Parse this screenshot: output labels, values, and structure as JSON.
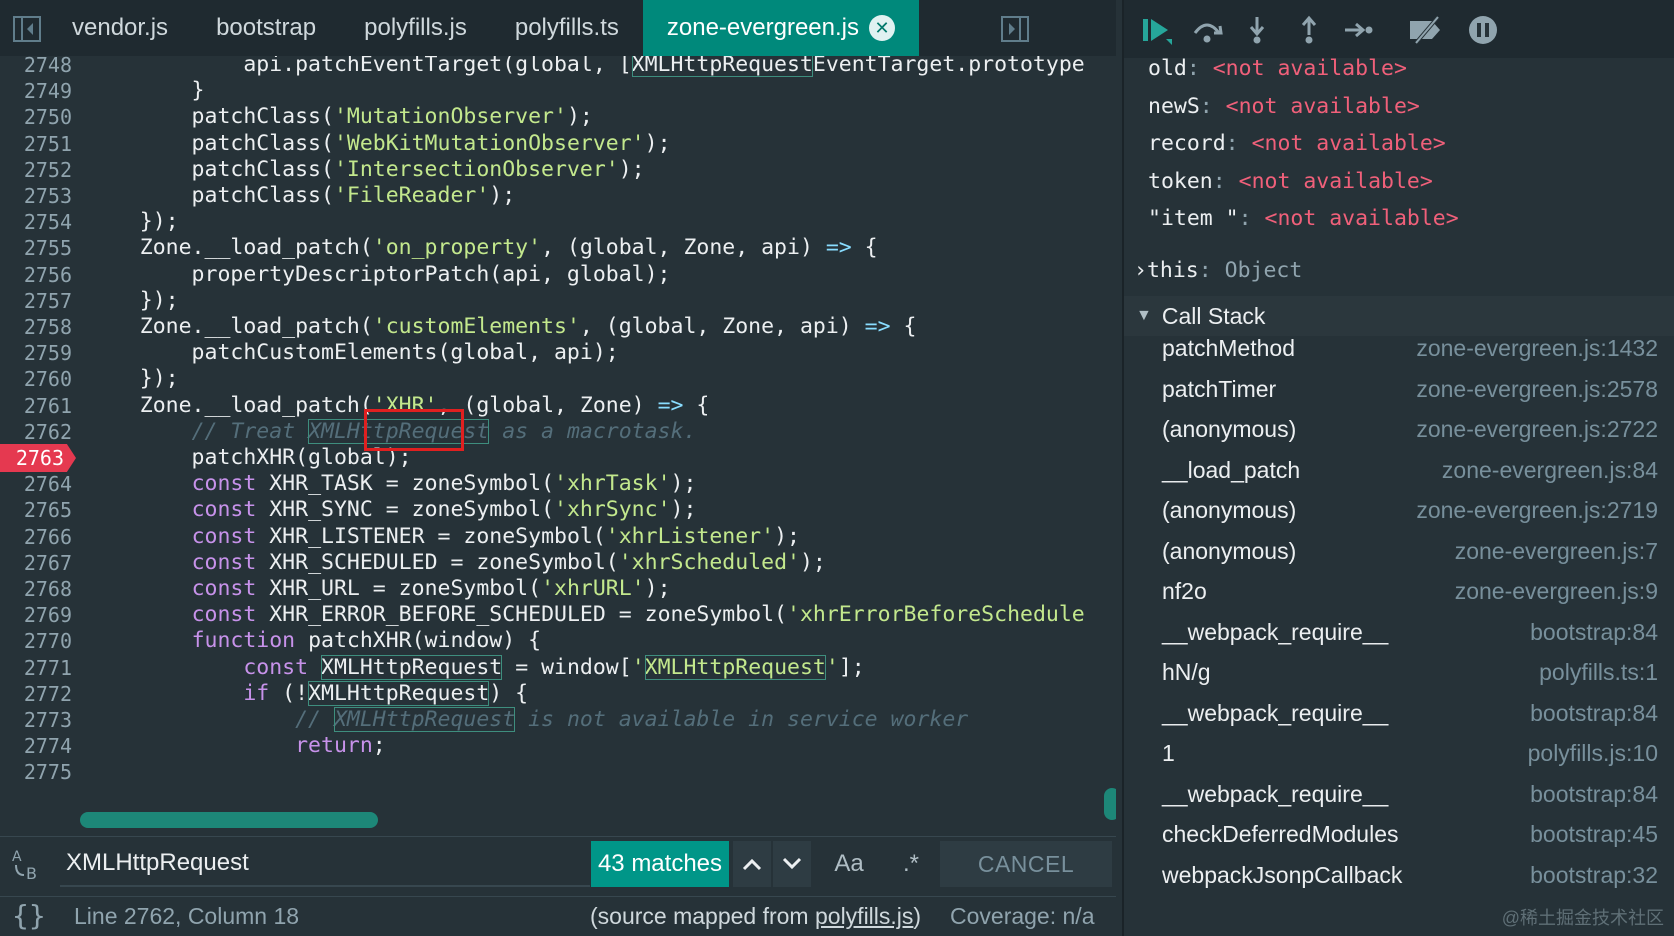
{
  "tabs": [
    {
      "label": "vendor.js",
      "active": false
    },
    {
      "label": "bootstrap",
      "active": false
    },
    {
      "label": "polyfills.js",
      "active": false
    },
    {
      "label": "polyfills.ts",
      "active": false
    },
    {
      "label": "zone-evergreen.js",
      "active": true
    }
  ],
  "code": {
    "breakpoint_line": "2763",
    "lines": [
      {
        "n": "2748",
        "html": "            api.patchEventTarget(global, [<span class='m'>XMLHttpRequest</span>EventTarget.prototype"
      },
      {
        "n": "2749",
        "html": "        }"
      },
      {
        "n": "2750",
        "html": "        patchClass(<span class='s'>'MutationObserver'</span>);"
      },
      {
        "n": "2751",
        "html": "        patchClass(<span class='s'>'WebKitMutationObserver'</span>);"
      },
      {
        "n": "2752",
        "html": "        patchClass(<span class='s'>'IntersectionObserver'</span>);"
      },
      {
        "n": "2753",
        "html": "        patchClass(<span class='s'>'FileReader'</span>);"
      },
      {
        "n": "2754",
        "html": "    });"
      },
      {
        "n": "2755",
        "html": "    Zone.__load_patch(<span class='s'>'on_property'</span>, (global, Zone, api) <span class='p'>=&gt;</span> {"
      },
      {
        "n": "2756",
        "html": "        propertyDescriptorPatch(api, global);"
      },
      {
        "n": "2757",
        "html": "    });"
      },
      {
        "n": "2758",
        "html": "    Zone.__load_patch(<span class='s'>'customElements'</span>, (global, Zone, api) <span class='p'>=&gt;</span> {"
      },
      {
        "n": "2759",
        "html": "        patchCustomElements(global, api);"
      },
      {
        "n": "2760",
        "html": "    });"
      },
      {
        "n": "2761",
        "html": "    Zone.__load_patch(<span class='s'>'XHR'</span>, (global, Zone) <span class='p'>=&gt;</span> {"
      },
      {
        "n": "2762",
        "html": "        <span class='c'>// Treat <span class='m'>XMLHttpRequest</span> as a macrotask.</span>"
      },
      {
        "n": "2763",
        "html": "        patchXHR(global);"
      },
      {
        "n": "2764",
        "html": "        <span class='k'>const</span> XHR_TASK = zoneSymbol(<span class='s'>'xhrTask'</span>);"
      },
      {
        "n": "2765",
        "html": "        <span class='k'>const</span> XHR_SYNC = zoneSymbol(<span class='s'>'xhrSync'</span>);"
      },
      {
        "n": "2766",
        "html": "        <span class='k'>const</span> XHR_LISTENER = zoneSymbol(<span class='s'>'xhrListener'</span>);"
      },
      {
        "n": "2767",
        "html": "        <span class='k'>const</span> XHR_SCHEDULED = zoneSymbol(<span class='s'>'xhrScheduled'</span>);"
      },
      {
        "n": "2768",
        "html": "        <span class='k'>const</span> XHR_URL = zoneSymbol(<span class='s'>'xhrURL'</span>);"
      },
      {
        "n": "2769",
        "html": "        <span class='k'>const</span> XHR_ERROR_BEFORE_SCHEDULED = zoneSymbol(<span class='s'>'xhrErrorBeforeSchedule</span>"
      },
      {
        "n": "2770",
        "html": "        <span class='k'>function</span> patchXHR(window) {"
      },
      {
        "n": "2771",
        "html": "            <span class='k'>const</span> <span class='m'>XMLHttpRequest</span> = window[<span class='s'>'<span class='m'>XMLHttpRequest</span>'</span>];"
      },
      {
        "n": "2772",
        "html": "            <span class='k'>if</span> (!<span class='m'>XMLHttpRequest</span>) {"
      },
      {
        "n": "2773",
        "html": "                <span class='c'>// <span class='m'>XMLHttpRequest</span> is not available in service worker</span>"
      },
      {
        "n": "2774",
        "html": "                <span class='k'>return</span>;"
      },
      {
        "n": "2775",
        "html": ""
      }
    ]
  },
  "search": {
    "query": "XMLHttpRequest",
    "matches_label": "43 matches",
    "case_label": "Aa",
    "regex_label": ".*",
    "cancel_label": "CANCEL"
  },
  "status": {
    "braces": "{}",
    "cursor": "Line 2762, Column 18",
    "source_prefix": "(source mapped from ",
    "source_link": "polyfills.js",
    "source_suffix": ")",
    "coverage": "Coverage: n/a"
  },
  "scope": [
    {
      "key": "old",
      "value": "<not available>"
    },
    {
      "key": "newS",
      "value": "<not available>"
    },
    {
      "key": "record",
      "value": "<not available>"
    },
    {
      "key": "token",
      "value": "<not available>"
    },
    {
      "key": "\"item \"",
      "value": "<not available>"
    }
  ],
  "this_row": {
    "key": "this",
    "value": "Object"
  },
  "callstack": {
    "title": "Call Stack",
    "frames": [
      {
        "fn": "patchMethod",
        "loc": "zone-evergreen.js:1432"
      },
      {
        "fn": "patchTimer",
        "loc": "zone-evergreen.js:2578"
      },
      {
        "fn": "(anonymous)",
        "loc": "zone-evergreen.js:2722"
      },
      {
        "fn": "__load_patch",
        "loc": "zone-evergreen.js:84"
      },
      {
        "fn": "(anonymous)",
        "loc": "zone-evergreen.js:2719"
      },
      {
        "fn": "(anonymous)",
        "loc": "zone-evergreen.js:7"
      },
      {
        "fn": "nf2o",
        "loc": "zone-evergreen.js:9"
      },
      {
        "fn": "__webpack_require__",
        "loc": "bootstrap:84"
      },
      {
        "fn": "hN/g",
        "loc": "polyfills.ts:1"
      },
      {
        "fn": "__webpack_require__",
        "loc": "bootstrap:84"
      },
      {
        "fn": "1",
        "loc": "polyfills.js:10"
      },
      {
        "fn": "__webpack_require__",
        "loc": "bootstrap:84"
      },
      {
        "fn": "checkDeferredModules",
        "loc": "bootstrap:45"
      },
      {
        "fn": "webpackJsonpCallback",
        "loc": "bootstrap:32"
      }
    ]
  },
  "watermark": "@稀土掘金技术社区",
  "colors": {
    "accent": "#009688",
    "breakpoint": "#e53950",
    "not_available": "#f0607a",
    "highlight_box": "#e02020"
  },
  "icons": [
    "sidebar-toggle-icon",
    "panel-toggle-icon",
    "resume-icon",
    "step-over-icon",
    "step-into-icon",
    "step-out-icon",
    "step-icon",
    "deactivate-breakpoints-icon",
    "pause-on-exceptions-icon",
    "case-sensitive-icon",
    "chevron-up-icon",
    "chevron-down-icon"
  ]
}
